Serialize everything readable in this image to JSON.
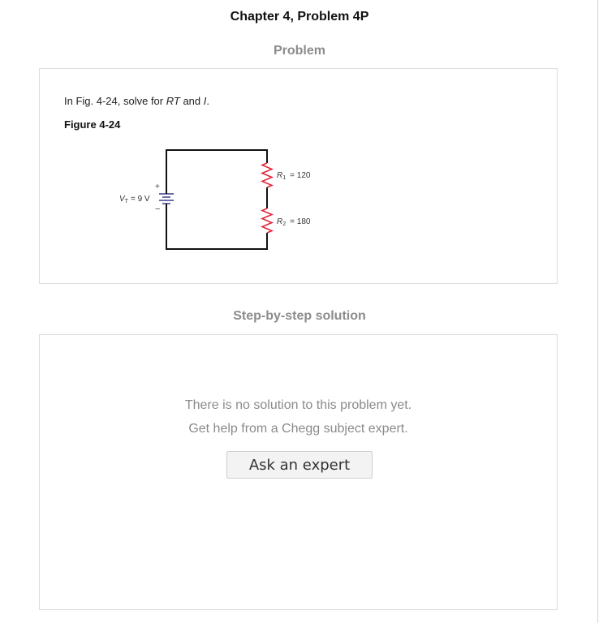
{
  "page": {
    "chapter_title": "Chapter 4, Problem 4P"
  },
  "problem": {
    "section_label": "Problem",
    "text_prefix": "In Fig. 4-24, solve for ",
    "text_var1": "RT",
    "text_mid": " and ",
    "text_var2": "I",
    "text_suffix": ".",
    "figure_label": "Figure 4-24",
    "circuit": {
      "source": {
        "label": "V",
        "subscript": "T",
        "value": "= 9 V",
        "plus": "+",
        "minus": "−"
      },
      "r1": {
        "label": "R",
        "subscript": "1",
        "value": "= 120 Ω"
      },
      "r2": {
        "label": "R",
        "subscript": "2",
        "value": "= 180 Ω"
      }
    }
  },
  "solution": {
    "section_label": "Step-by-step solution",
    "message_line1": "There is no solution to this problem yet.",
    "message_line2": "Get help from a Chegg subject expert.",
    "ask_button_label": "Ask an expert"
  },
  "colors": {
    "resistor": "#e0283c",
    "battery": "#3a3d8c",
    "wire": "#111111"
  }
}
